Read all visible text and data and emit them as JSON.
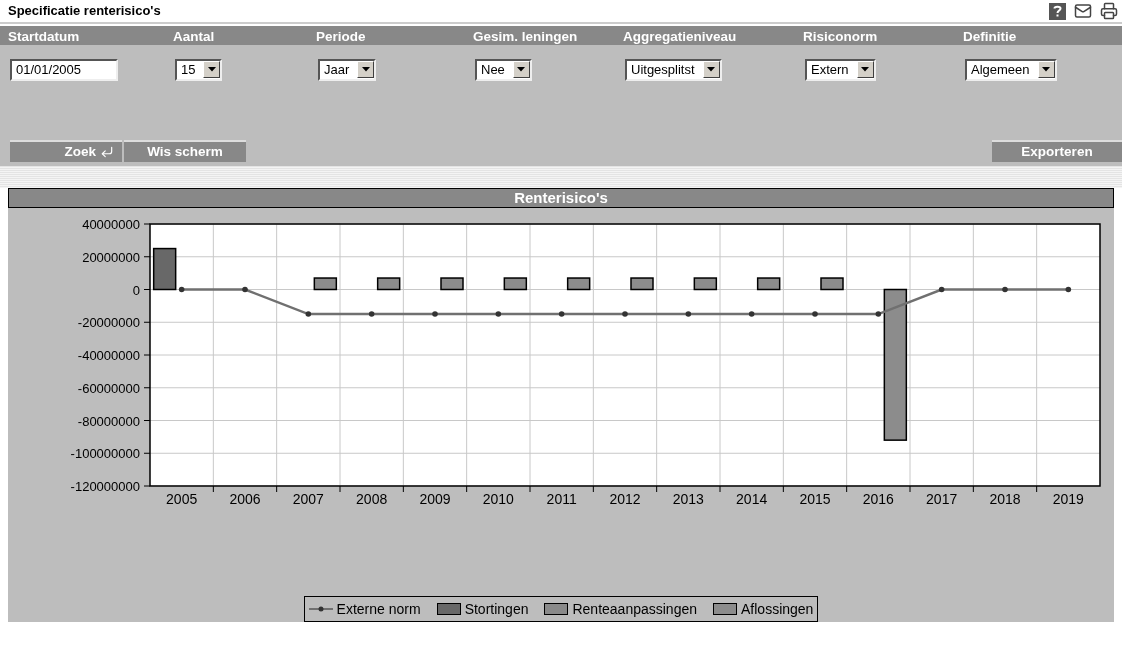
{
  "page": {
    "title": "Specificatie renterisico's"
  },
  "filters": [
    {
      "label": "Startdatum",
      "kind": "text",
      "value": "01/01/2005"
    },
    {
      "label": "Aantal",
      "kind": "select",
      "value": "15"
    },
    {
      "label": "Periode",
      "kind": "select",
      "value": "Jaar"
    },
    {
      "label": "Gesim. leningen",
      "kind": "select",
      "value": "Nee"
    },
    {
      "label": "Aggregatieniveau",
      "kind": "select",
      "value": "Uitgesplitst"
    },
    {
      "label": "Risiconorm",
      "kind": "select",
      "value": "Extern"
    },
    {
      "label": "Definitie",
      "kind": "select",
      "value": "Algemeen"
    }
  ],
  "buttons": [
    {
      "label": "Zoek",
      "kind": "search"
    },
    {
      "label": "Wis scherm",
      "kind": "clear"
    },
    {
      "label": "Exporteren",
      "kind": "export"
    }
  ],
  "chart": {
    "title": "Renterisico's",
    "chart_data": {
      "type": "bar",
      "stacked": false,
      "grid": true,
      "categories": [
        "2005",
        "2006",
        "2007",
        "2008",
        "2009",
        "2010",
        "2011",
        "2012",
        "2013",
        "2014",
        "2015",
        "2016",
        "2017",
        "2018",
        "2019"
      ],
      "ylim": [
        -120000000,
        40000000
      ],
      "yticks": [
        {
          "value": 40000000,
          "label": "40000000"
        },
        {
          "value": 20000000,
          "label": "20000000"
        },
        {
          "value": 0,
          "label": "0"
        },
        {
          "value": -20000000,
          "label": "-20000000"
        },
        {
          "value": -40000000,
          "label": "-40000000"
        },
        {
          "value": -60000000,
          "label": "-60000000"
        },
        {
          "value": -80000000,
          "label": "-80000000"
        },
        {
          "value": -100000000,
          "label": "-100000000"
        },
        {
          "value": -120000000,
          "label": "-120000000"
        }
      ],
      "series": [
        {
          "name": "Externe norm",
          "type": "line",
          "color": "#707070",
          "values": [
            0,
            0,
            -15000000,
            -15000000,
            -15000000,
            -15000000,
            -15000000,
            -15000000,
            -15000000,
            -15000000,
            -15000000,
            -15000000,
            0,
            0,
            0
          ]
        },
        {
          "name": "Stortingen",
          "type": "bar",
          "color": "#686868",
          "values": [
            25000000,
            null,
            null,
            null,
            null,
            null,
            null,
            null,
            null,
            null,
            null,
            null,
            null,
            null,
            null
          ]
        },
        {
          "name": "Renteaanpassingen",
          "type": "bar",
          "color": "#8a8a8a",
          "values": [
            null,
            null,
            null,
            null,
            null,
            null,
            null,
            null,
            null,
            null,
            null,
            null,
            null,
            null,
            null
          ]
        },
        {
          "name": "Aflossingen",
          "type": "bar",
          "color": "#8c8c8c",
          "values": [
            null,
            null,
            7000000,
            7000000,
            7000000,
            7000000,
            7000000,
            7000000,
            7000000,
            7000000,
            7000000,
            -92000000,
            null,
            null,
            null
          ]
        }
      ]
    }
  }
}
